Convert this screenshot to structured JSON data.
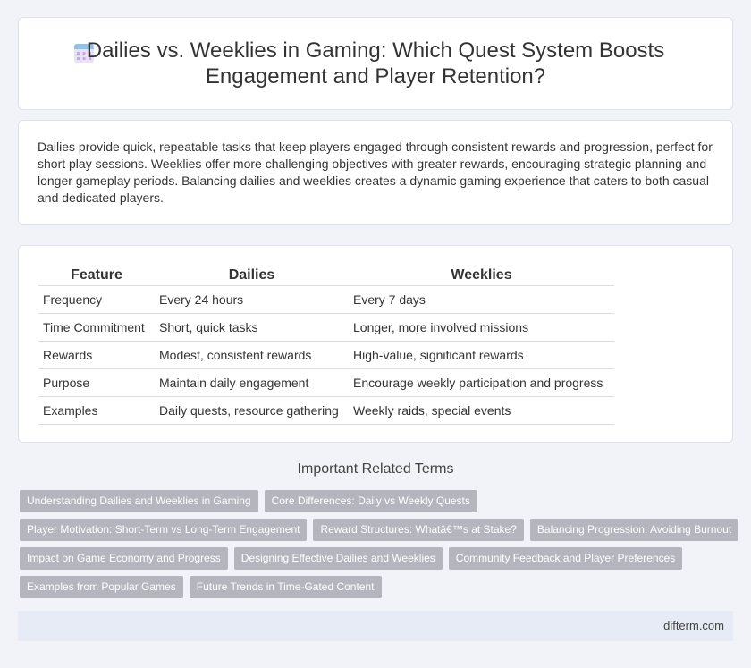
{
  "header": {
    "title": "Dailies vs. Weeklies in Gaming: Which Quest System Boosts Engagement and Player Retention?",
    "icon": "calendar-icon"
  },
  "summary": {
    "text": "Dailies provide quick, repeatable tasks that keep players engaged through consistent rewards and progression, perfect for short play sessions. Weeklies offer more challenging objectives with greater rewards, encouraging strategic planning and longer gameplay periods. Balancing dailies and weeklies creates a dynamic gaming experience that caters to both casual and dedicated players."
  },
  "table": {
    "headers": [
      "Feature",
      "Dailies",
      "Weeklies"
    ],
    "rows": [
      [
        "Frequency",
        "Every 24 hours",
        "Every 7 days"
      ],
      [
        "Time Commitment",
        "Short, quick tasks",
        "Longer, more involved missions"
      ],
      [
        "Rewards",
        "Modest, consistent rewards",
        "High-value, significant rewards"
      ],
      [
        "Purpose",
        "Maintain daily engagement",
        "Encourage weekly participation and progress"
      ],
      [
        "Examples",
        "Daily quests, resource gathering",
        "Weekly raids, special events"
      ]
    ]
  },
  "related": {
    "title": "Important Related Terms",
    "rows": [
      [
        "Understanding Dailies and Weeklies in Gaming",
        "Core Differences: Daily vs Weekly Quests"
      ],
      [
        "Player Motivation: Short-Term vs Long-Term Engagement",
        "Reward Structures: Whatâ€™s at Stake?",
        "Balancing Progression: Avoiding Burnout"
      ],
      [
        "Impact on Game Economy and Progress",
        "Designing Effective Dailies and Weeklies",
        "Community Feedback and Player Preferences"
      ],
      [
        "Examples from Popular Games",
        "Future Trends in Time-Gated Content"
      ]
    ]
  },
  "footer": {
    "site": "difterm.com"
  },
  "colors": {
    "page_bg": "#f1f3f8",
    "tag_bg": "#b3b6bd",
    "footer_bg": "#e6ebf5"
  }
}
